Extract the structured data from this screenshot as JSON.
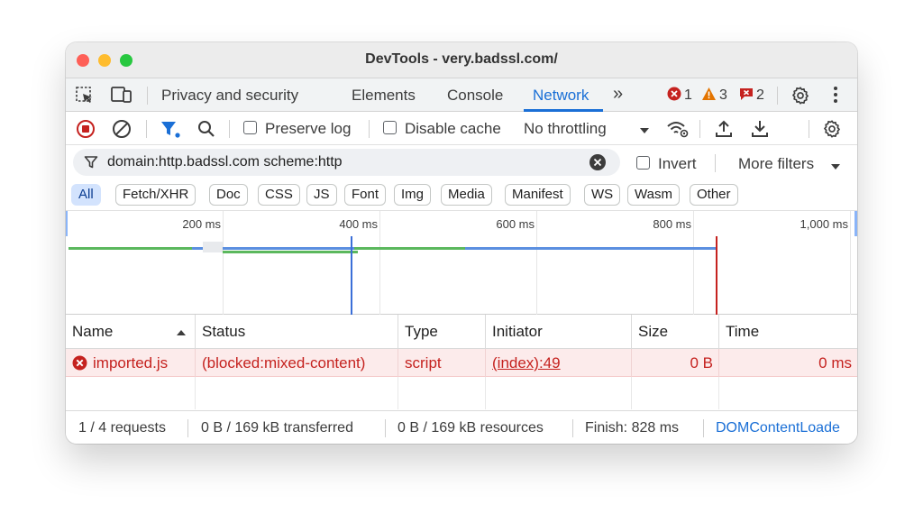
{
  "window": {
    "title": "DevTools - very.badssl.com/"
  },
  "tabs": {
    "items": [
      "Privacy and security",
      "Elements",
      "Console",
      "Network"
    ],
    "active": "Network",
    "more_label": "»",
    "badges": {
      "errors": "1",
      "warnings": "3",
      "issues": "2"
    }
  },
  "toolbar": {
    "preserve_log": "Preserve log",
    "disable_cache": "Disable cache",
    "throttling": "No throttling"
  },
  "filter": {
    "query": "domain:http.badssl.com scheme:http",
    "invert": "Invert",
    "more_filters": "More filters"
  },
  "chips": [
    "All",
    "Fetch/XHR",
    "Doc",
    "CSS",
    "JS",
    "Font",
    "Img",
    "Media",
    "Manifest",
    "WS",
    "Wasm",
    "Other"
  ],
  "overview": {
    "ticks": [
      "200 ms",
      "400 ms",
      "600 ms",
      "800 ms",
      "1,000 ms"
    ]
  },
  "table": {
    "columns": [
      "Name",
      "Status",
      "Type",
      "Initiator",
      "Size",
      "Time"
    ],
    "rows": [
      {
        "name": "imported.js",
        "status": "(blocked:mixed-content)",
        "type": "script",
        "initiator": "(index):49",
        "size": "0 B",
        "time": "0 ms"
      }
    ]
  },
  "status": {
    "requests": "1 / 4 requests",
    "transferred": "0 B / 169 kB transferred",
    "resources": "0 B / 169 kB resources",
    "finish": "Finish: 828 ms",
    "dom_loaded": "DOMContentLoade"
  },
  "colors": {
    "accent": "#1a6fd6",
    "error": "#c5221f",
    "error_row": "#fcebeb",
    "warning": "#e37400"
  }
}
